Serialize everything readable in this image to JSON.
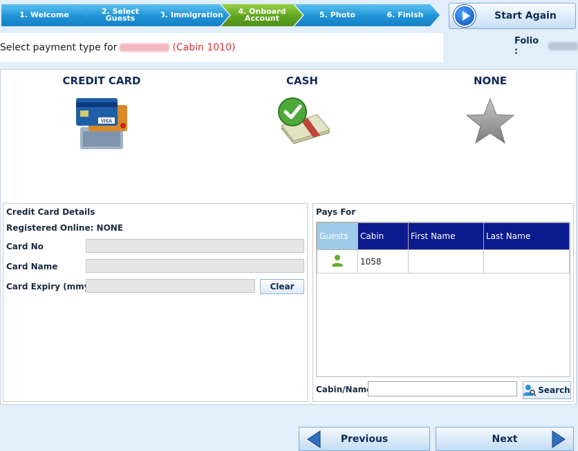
{
  "steps": [
    {
      "line1": "1. Welcome",
      "line2": ""
    },
    {
      "line1": "2. Select",
      "line2": "Guests"
    },
    {
      "line1": "3. Immigration",
      "line2": ""
    },
    {
      "line1": "4. Onboard",
      "line2": "Account"
    },
    {
      "line1": "5. Photo",
      "line2": ""
    },
    {
      "line1": "6. Finish",
      "line2": ""
    }
  ],
  "header": {
    "start_again": "Start Again",
    "prompt": "Select payment type for",
    "cabin_ref": "(Cabin 1010)",
    "folio_label": "Folio :"
  },
  "payment_options": {
    "credit_card": "CREDIT CARD",
    "cash": "CASH",
    "none": "NONE"
  },
  "card_details": {
    "title": "Credit Card Details",
    "registered_online": "Registered Online: NONE",
    "card_no_label": "Card No",
    "card_no_value": "",
    "card_name_label": "Card Name",
    "card_name_value": "",
    "card_expiry_label": "Card Expiry (mmyy)",
    "card_expiry_value": "",
    "clear": "Clear"
  },
  "pays_for": {
    "title": "Pays For",
    "columns": [
      "Guests",
      "Cabin",
      "First Name",
      "Last Name"
    ],
    "rows": [
      {
        "cabin": "1058",
        "first_name": "",
        "last_name": ""
      }
    ],
    "cabin_name_label": "Cabin/Name",
    "cabin_name_value": "",
    "search": "Search"
  },
  "nav": {
    "previous": "Previous",
    "next": "Next"
  },
  "colors": {
    "step_blue": "#1f93d6",
    "step_active": "#5fa51f",
    "table_header": "#0b1a8c",
    "guests_header": "#9ecbe8",
    "accent_red": "#d32f2f"
  }
}
